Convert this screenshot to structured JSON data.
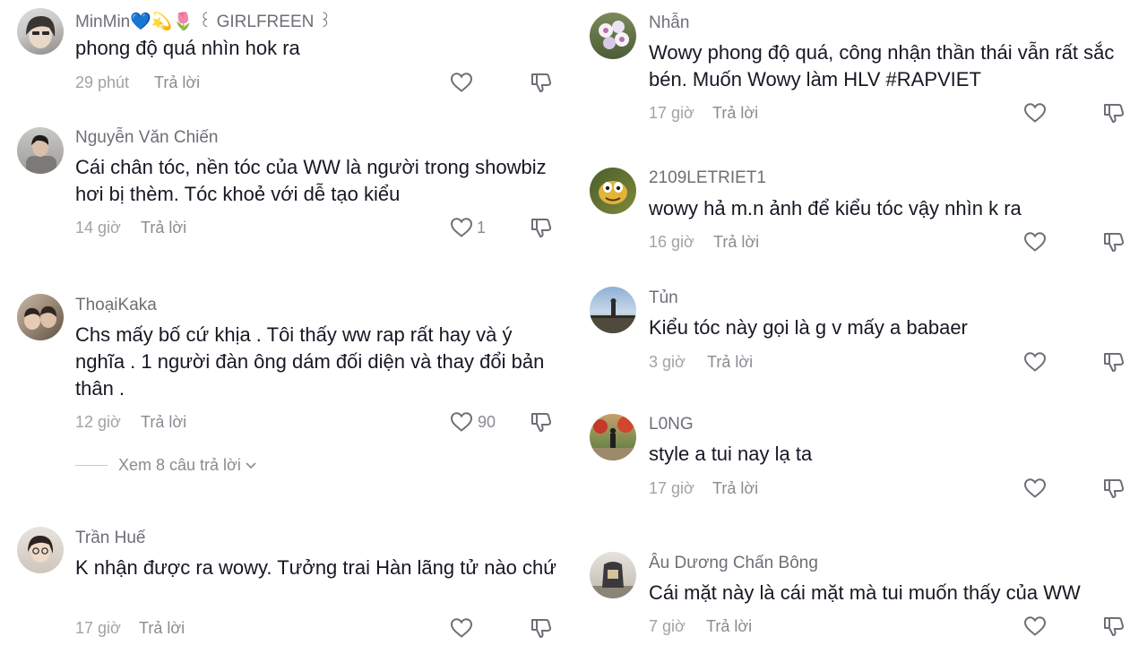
{
  "left": [
    {
      "username": "MinMin💙💫🌷 ꒰ GIRLFREEN ꒱",
      "text": "phong độ quá nhìn hok ra",
      "time": "29 phút",
      "reply": "Trả lời",
      "likes": ""
    },
    {
      "username": "Nguyễn Văn Chiến",
      "text": "Cái chân tóc, nền tóc của WW là người trong showbiz hơi bị thèm. Tóc khoẻ với dễ tạo kiểu",
      "time": "14 giờ",
      "reply": "Trả lời",
      "likes": "1"
    },
    {
      "username": "ThoạiKaka",
      "text": "Chs mấy bố cứ khịa . Tôi thấy ww rap rất hay và ý nghĩa . 1 người đàn ông dám đối diện và thay đổi bản thân .",
      "time": "12 giờ",
      "reply": "Trả lời",
      "likes": "90",
      "view_replies": "Xem 8 câu trả lời"
    },
    {
      "username": "Trần Huế",
      "text": "K nhận được ra wowy. Tưởng trai Hàn lãng tử nào chứ",
      "time": "17 giờ",
      "reply": "Trả lời",
      "likes": ""
    }
  ],
  "right": [
    {
      "username": "Nhẫn",
      "text": "Wowy phong độ quá, công nhận thần thái vẫn rất sắc bén. Muốn Wowy làm HLV #RAPVIET",
      "time": "17 giờ",
      "reply": "Trả lời",
      "likes": ""
    },
    {
      "username": "2109LETRIET1",
      "text": "wowy hả m.n ảnh để kiểu tóc vậy nhìn k ra",
      "time": "16 giờ",
      "reply": "Trả lời",
      "likes": ""
    },
    {
      "username": "Tủn",
      "text": "Kiểu tóc này gọi là g v mấy a babaer",
      "time": "3 giờ",
      "reply": "Trả lời",
      "likes": ""
    },
    {
      "username": "L0NG",
      "text": "style a tui nay lạ ta",
      "time": "17 giờ",
      "reply": "Trả lời",
      "likes": ""
    },
    {
      "username": "Âu Dương Chấn Bông",
      "text": "Cái mặt này là cái mặt mà tui muốn thấy của WW",
      "time": "7 giờ",
      "reply": "Trả lời",
      "likes": ""
    }
  ],
  "icons": {
    "like": "heart-outline-icon",
    "dislike": "thumbs-down-icon",
    "chevron": "chevron-down-icon"
  },
  "colors": {
    "text": "#161823",
    "username": "#6e6f76",
    "meta": "#a1a2a7",
    "icon": "#6e6f76"
  }
}
